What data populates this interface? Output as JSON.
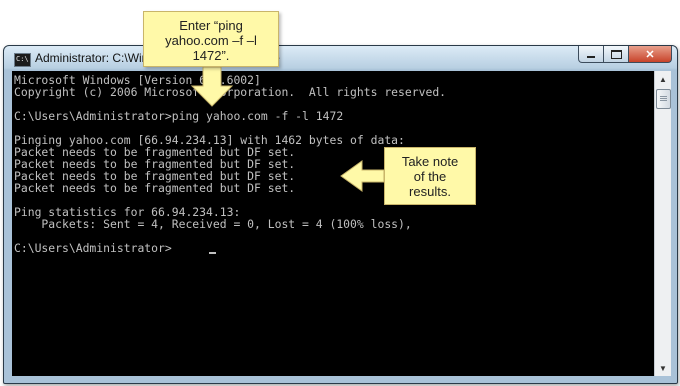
{
  "window": {
    "icon_label": "C:\\",
    "title": "Administrator: C:\\Windows\\system32\\cmd.exe"
  },
  "console": {
    "lines": [
      "Microsoft Windows [Version 6.0.6002]",
      "Copyright (c) 2006 Microsoft Corporation.  All rights reserved.",
      "",
      "C:\\Users\\Administrator>ping yahoo.com -f -l 1472",
      "",
      "Pinging yahoo.com [66.94.234.13] with 1462 bytes of data:",
      "Packet needs to be fragmented but DF set.",
      "Packet needs to be fragmented but DF set.",
      "Packet needs to be fragmented but DF set.",
      "Packet needs to be fragmented but DF set.",
      "",
      "Ping statistics for 66.94.234.13:",
      "    Packets: Sent = 4, Received = 0, Lost = 4 (100% loss),",
      "",
      "C:\\Users\\Administrator>"
    ]
  },
  "callouts": {
    "top": [
      "Enter “ping",
      "yahoo.com –f –l",
      "1472”."
    ],
    "right": [
      "Take note",
      "of the",
      "results."
    ]
  },
  "colors": {
    "console_bg": "#000000",
    "console_text": "#c0c0c0",
    "callout_bg": "#fff9a8",
    "close_button": "#c8432a"
  },
  "icons": [
    "cmd-app-icon",
    "minimize-icon",
    "maximize-icon",
    "close-icon",
    "scroll-up-icon",
    "scroll-down-icon"
  ]
}
